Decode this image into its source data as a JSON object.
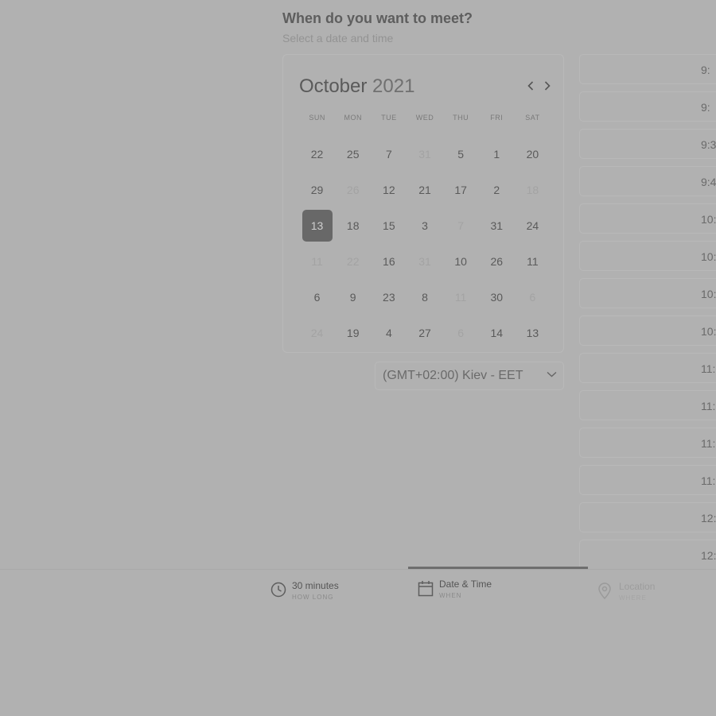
{
  "header": {
    "title": "When do you want to meet?",
    "subtitle": "Select a date and time"
  },
  "calendar": {
    "month": "October",
    "year": "2021",
    "prev_icon": "chevron-left-icon",
    "next_icon": "chevron-right-icon",
    "weekdays": [
      "SUN",
      "MON",
      "TUE",
      "WED",
      "THU",
      "FRI",
      "SAT"
    ],
    "weeks": [
      [
        {
          "d": "22",
          "s": "a"
        },
        {
          "d": "25",
          "s": "a"
        },
        {
          "d": "7",
          "s": "a"
        },
        {
          "d": "31",
          "s": "m"
        },
        {
          "d": "5",
          "s": "a"
        },
        {
          "d": "1",
          "s": "a"
        },
        {
          "d": "20",
          "s": "a"
        }
      ],
      [
        {
          "d": "29",
          "s": "a"
        },
        {
          "d": "26",
          "s": "m"
        },
        {
          "d": "12",
          "s": "a"
        },
        {
          "d": "21",
          "s": "a"
        },
        {
          "d": "17",
          "s": "a"
        },
        {
          "d": "2",
          "s": "a"
        },
        {
          "d": "18",
          "s": "m"
        }
      ],
      [
        {
          "d": "13",
          "s": "sel"
        },
        {
          "d": "18",
          "s": "a"
        },
        {
          "d": "15",
          "s": "a"
        },
        {
          "d": "3",
          "s": "a"
        },
        {
          "d": "7",
          "s": "m"
        },
        {
          "d": "31",
          "s": "a"
        },
        {
          "d": "24",
          "s": "a"
        }
      ],
      [
        {
          "d": "11",
          "s": "m"
        },
        {
          "d": "22",
          "s": "m"
        },
        {
          "d": "16",
          "s": "a"
        },
        {
          "d": "31",
          "s": "m"
        },
        {
          "d": "10",
          "s": "a"
        },
        {
          "d": "26",
          "s": "a"
        },
        {
          "d": "11",
          "s": "a"
        }
      ],
      [
        {
          "d": "6",
          "s": "a"
        },
        {
          "d": "9",
          "s": "a"
        },
        {
          "d": "23",
          "s": "a"
        },
        {
          "d": "8",
          "s": "a"
        },
        {
          "d": "11",
          "s": "m"
        },
        {
          "d": "30",
          "s": "a"
        },
        {
          "d": "6",
          "s": "m"
        }
      ],
      [
        {
          "d": "24",
          "s": "m"
        },
        {
          "d": "19",
          "s": "a"
        },
        {
          "d": "4",
          "s": "a"
        },
        {
          "d": "27",
          "s": "a"
        },
        {
          "d": "6",
          "s": "m"
        },
        {
          "d": "14",
          "s": "a"
        },
        {
          "d": "13",
          "s": "a"
        }
      ]
    ]
  },
  "timezone": {
    "value": "(GMT+02:00) Kiev - EET",
    "icon": "chevron-down-icon"
  },
  "time_slots": [
    "9:",
    "9:",
    "9:3",
    "9:4",
    "10:",
    "10:",
    "10:",
    "10:",
    "11:",
    "11:",
    "11:",
    "11:",
    "12:",
    "12:"
  ],
  "steps": [
    {
      "label": "30 minutes",
      "sub": "HOW LONG",
      "icon": "clock-icon"
    },
    {
      "label": "Date & Time",
      "sub": "WHEN",
      "icon": "calendar-icon"
    },
    {
      "label": "Location",
      "sub": "WHERE",
      "icon": "location-pin-icon"
    }
  ],
  "colors": {
    "background": "#b1b1b1",
    "selected_day": "#686868",
    "active_step_bar": "#6e6e6e"
  }
}
